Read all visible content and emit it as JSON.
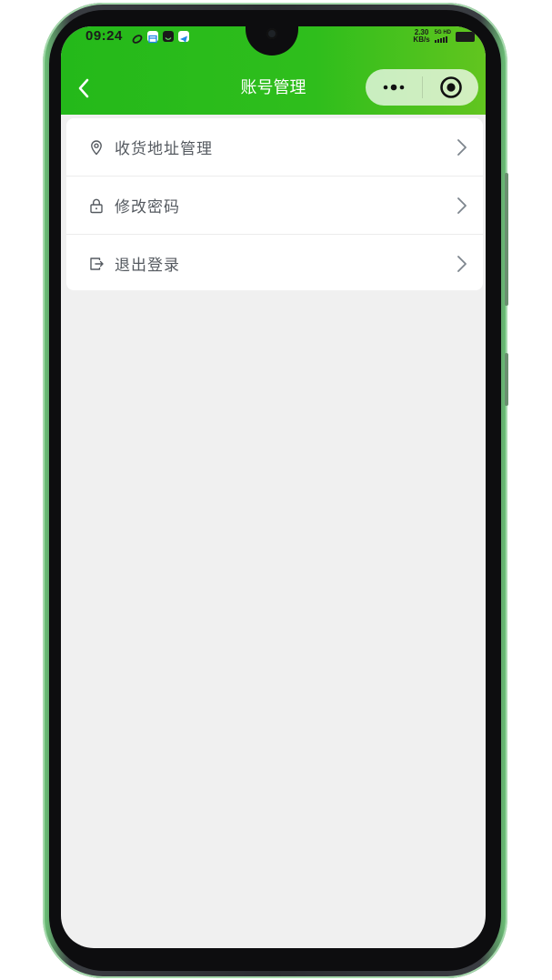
{
  "status_bar": {
    "time": "09:24",
    "net_speed_value": "2.30",
    "net_speed_unit": "KB/s",
    "network_label": "5G HD",
    "app_icons": [
      "sync-icon",
      "calendar-icon",
      "shopping-bag-icon",
      "telegram-icon"
    ]
  },
  "header": {
    "title": "账号管理",
    "back_icon": "chevron-left-icon",
    "capsule": {
      "more_icon": "more-dots-icon",
      "close_icon": "target-circle-icon"
    },
    "gradient_start": "#24b91a",
    "gradient_end": "#62c51f"
  },
  "menu": {
    "items": [
      {
        "label": "收货地址管理",
        "icon": "location-pin-icon"
      },
      {
        "label": "修改密码",
        "icon": "lock-icon"
      },
      {
        "label": "退出登录",
        "icon": "logout-icon"
      }
    ]
  },
  "colors": {
    "page_background": "#f0f0f0",
    "card_background": "#ffffff",
    "item_text": "#555a60",
    "accent": "#24b91a"
  }
}
